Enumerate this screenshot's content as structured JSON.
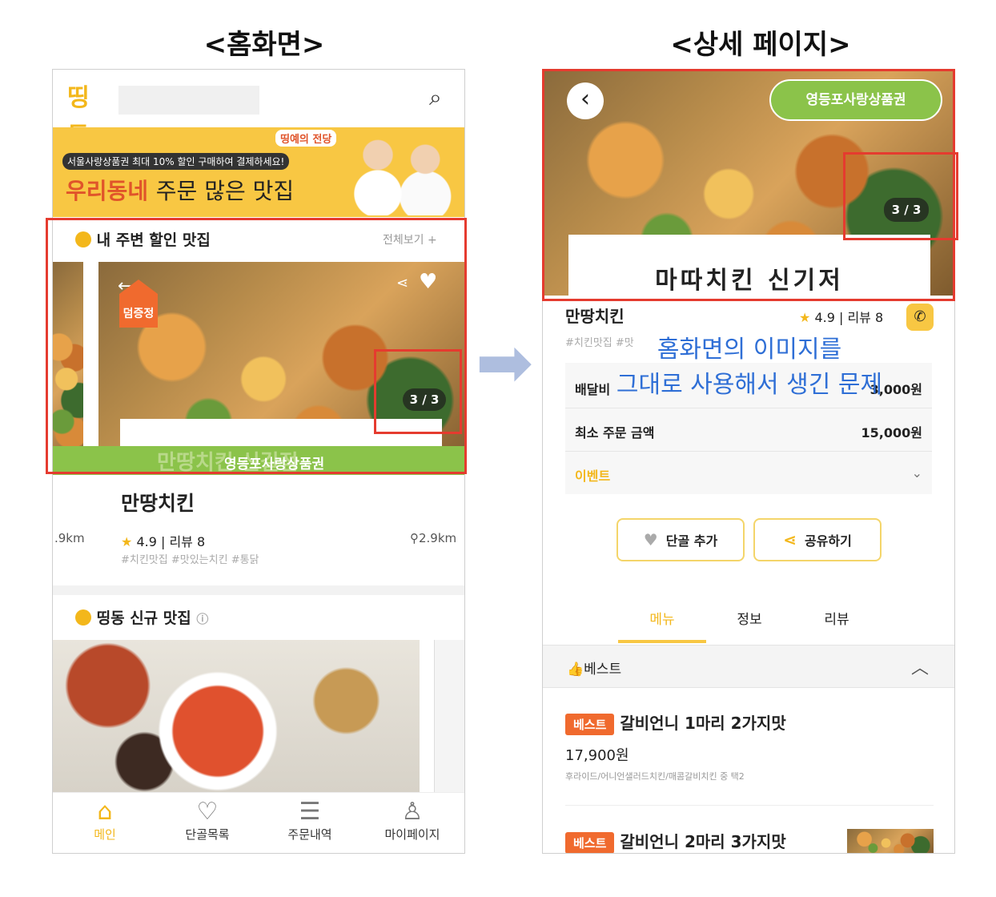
{
  "headings": {
    "home": "<홈화면>",
    "detail": "<상세 페이지>"
  },
  "home": {
    "logo": "띵동",
    "banner": {
      "tagline": "띵예의 전당",
      "subtitle": "서울사랑상품권 최대 10% 할인 구매하여 결제하세요!",
      "title_accent": "우리동네",
      "title_rest": "주문 많은 맛집"
    },
    "section1": {
      "title": "내 주변 할인 맛집",
      "see_all": "전체보기 +"
    },
    "card": {
      "badge": "덤증정",
      "counter": "3 / 3",
      "voucher": "영등포사랑상품권",
      "ghost_title": "만땅치킨 신길점",
      "name": "만땅치킨",
      "rating": "4.9 | 리뷰 8",
      "distance": "2.9km",
      "distance_left": ".9km",
      "tags": "#치킨맛집 #맛있는치킨 #통닭"
    },
    "section2": {
      "title": "띵동 신규 맛집"
    },
    "nav": [
      {
        "label": "메인",
        "icon": "⌂"
      },
      {
        "label": "단골목록",
        "icon": "♡"
      },
      {
        "label": "주문내역",
        "icon": "☰"
      },
      {
        "label": "마이페이지",
        "icon": "♙"
      }
    ]
  },
  "arrow": "➡",
  "detail": {
    "back": "‹",
    "voucher": "영등포사랑상품권",
    "counter": "3 / 3",
    "image_title": "마따치킨 신기저",
    "name": "만땅치킨",
    "rating": "4.9 | 리뷰 8",
    "tags": "#치킨맛집 #맛",
    "overlay_line1": "홈화면의 이미지를",
    "overlay_line2": "그대로 사용해서 생긴 문제",
    "delivery_label": "배달비",
    "delivery_value": "3,000원",
    "min_label": "최소 주문 금액",
    "min_value": "15,000원",
    "event_label": "이벤트",
    "fav_button": "단골 추가",
    "share_button": "공유하기",
    "tabs": [
      "메뉴",
      "정보",
      "리뷰"
    ],
    "best_section": "베스트",
    "best_tag": "베스트",
    "menu1": {
      "name": "갈비언니 1마리 2가지맛",
      "price": "17,900원",
      "desc": "후라이드/어니언샐러드치킨/매콤갈비치킨 중 택2"
    },
    "menu2": {
      "name": "갈비언니 2마리 3가지맛"
    }
  },
  "colors": {
    "accent": "#f3b71b",
    "red_box": "#e53b2f",
    "green": "#8bc34a",
    "overlay_text": "#2f6fd6"
  }
}
